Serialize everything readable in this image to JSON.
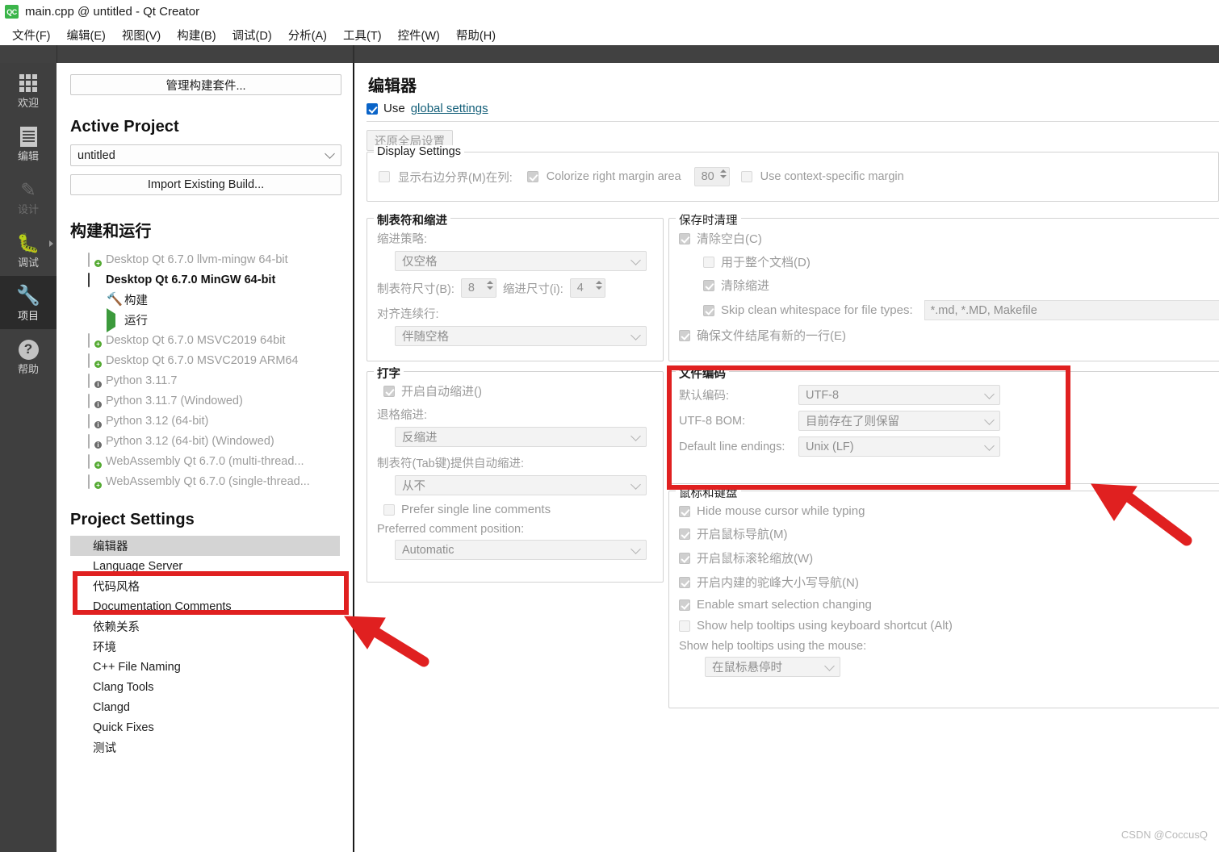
{
  "window": {
    "app_icon_label": "QC",
    "title": "main.cpp @ untitled - Qt Creator"
  },
  "menubar": [
    {
      "label": "文件(F)"
    },
    {
      "label": "编辑(E)"
    },
    {
      "label": "视图(V)"
    },
    {
      "label": "构建(B)"
    },
    {
      "label": "调试(D)"
    },
    {
      "label": "分析(A)"
    },
    {
      "label": "工具(T)"
    },
    {
      "label": "控件(W)"
    },
    {
      "label": "帮助(H)"
    }
  ],
  "mode_rail": [
    {
      "label": "欢迎",
      "icon": "grid-icon",
      "state": "normal"
    },
    {
      "label": "编辑",
      "icon": "document-icon",
      "state": "normal"
    },
    {
      "label": "设计",
      "icon": "pencil-icon",
      "state": "disabled"
    },
    {
      "label": "调试",
      "icon": "bug-icon",
      "state": "normal"
    },
    {
      "label": "项目",
      "icon": "wrench-icon",
      "state": "selected"
    },
    {
      "label": "帮助",
      "icon": "question-mark-icon",
      "state": "normal"
    }
  ],
  "left_panel": {
    "manage_kits_button": "管理构建套件...",
    "active_project_heading": "Active Project",
    "project_combo_value": "untitled",
    "import_build_button": "Import Existing Build...",
    "build_run_heading": "构建和运行",
    "kits": [
      {
        "label": "Desktop Qt 6.7.0 llvm-mingw 64-bit",
        "icon": "screen-plus-icon",
        "state": "disabled",
        "level": 0
      },
      {
        "label": "Desktop Qt 6.7.0 MinGW 64-bit",
        "icon": "screen-icon",
        "state": "active",
        "level": 0
      },
      {
        "label": "构建",
        "icon": "hammer-icon",
        "state": "normal",
        "level": 1
      },
      {
        "label": "运行",
        "icon": "play-icon",
        "state": "normal",
        "level": 1
      },
      {
        "label": "Desktop Qt 6.7.0 MSVC2019 64bit",
        "icon": "screen-plus-icon",
        "state": "disabled",
        "level": 0
      },
      {
        "label": "Desktop Qt 6.7.0 MSVC2019 ARM64",
        "icon": "screen-plus-icon",
        "state": "disabled",
        "level": 0
      },
      {
        "label": "Python 3.11.7",
        "icon": "screen-info-icon",
        "state": "disabled",
        "level": 0
      },
      {
        "label": "Python 3.11.7 (Windowed)",
        "icon": "screen-info-icon",
        "state": "disabled",
        "level": 0
      },
      {
        "label": "Python 3.12 (64-bit)",
        "icon": "screen-info-icon",
        "state": "disabled",
        "level": 0
      },
      {
        "label": "Python 3.12 (64-bit) (Windowed)",
        "icon": "screen-info-icon",
        "state": "disabled",
        "level": 0
      },
      {
        "label": "WebAssembly Qt 6.7.0 (multi-thread...",
        "icon": "screen-plus-icon",
        "state": "disabled",
        "level": 0
      },
      {
        "label": "WebAssembly Qt 6.7.0 (single-thread...",
        "icon": "screen-plus-icon",
        "state": "disabled",
        "level": 0
      }
    ],
    "project_settings_heading": "Project Settings",
    "settings": [
      {
        "label": "编辑器",
        "selected": true
      },
      {
        "label": "Language Server",
        "selected": false
      },
      {
        "label": "代码风格",
        "selected": false
      },
      {
        "label": "Documentation Comments",
        "selected": false
      },
      {
        "label": "依赖关系",
        "selected": false
      },
      {
        "label": "环境",
        "selected": false
      },
      {
        "label": "C++ File Naming",
        "selected": false
      },
      {
        "label": "Clang Tools",
        "selected": false
      },
      {
        "label": "Clangd",
        "selected": false
      },
      {
        "label": "Quick Fixes",
        "selected": false
      },
      {
        "label": "测试",
        "selected": false
      }
    ]
  },
  "main": {
    "page_title": "编辑器",
    "use_prefix": "Use",
    "use_global_link": "global settings",
    "restore_button": "还原全局设置",
    "display_settings": {
      "title": "Display Settings",
      "show_right_margin_label": "显示右边分界(M)在列:",
      "colorize_label": "Colorize right margin area",
      "margin_value": "80",
      "context_specific_label": "Use context-specific margin"
    },
    "tabs_indent": {
      "title": "制表符和缩进",
      "indent_policy_label": "缩进策略:",
      "indent_policy_value": "仅空格",
      "tab_size_label": "制表符尺寸(B):",
      "tab_size_value": "8",
      "indent_size_label": "缩进尺寸(i):",
      "indent_size_value": "4",
      "align_cont_label": "对齐连续行:",
      "align_cont_value": "伴随空格"
    },
    "typing": {
      "title": "打字",
      "auto_indent_label": "开启自动缩进()",
      "backspace_label": "退格缩进:",
      "backspace_value": "反缩进",
      "tab_auto_indent_label": "制表符(Tab键)提供自动缩进:",
      "tab_auto_indent_value": "从不",
      "prefer_single_line_label": "Prefer single line comments",
      "preferred_comment_pos_label": "Preferred comment position:",
      "preferred_comment_pos_value": "Automatic"
    },
    "cleanup": {
      "title": "保存时清理",
      "clean_whitespace_label": "清除空白(C)",
      "whole_document_label": "用于整个文档(D)",
      "clean_indentation_label": "清除缩进",
      "skip_clean_label": "Skip clean whitespace for file types:",
      "skip_clean_value": "*.md, *.MD, Makefile",
      "ensure_newline_label": "确保文件结尾有新的一行(E)"
    },
    "file_encoding": {
      "title": "文件编码",
      "default_encoding_label": "默认编码:",
      "default_encoding_value": "UTF-8",
      "bom_label": "UTF-8 BOM:",
      "bom_value": "目前存在了则保留",
      "line_endings_label": "Default line endings:",
      "line_endings_value": "Unix (LF)"
    },
    "mouse_keyboard": {
      "title": "鼠标和键盘",
      "hide_cursor_label": "Hide mouse cursor while typing",
      "mouse_nav_label": "开启鼠标导航(M)",
      "wheel_zoom_label": "开启鼠标滚轮缩放(W)",
      "camel_case_label": "开启内建的驼峰大小写导航(N)",
      "smart_selection_label": "Enable smart selection changing",
      "tooltip_shortcut_label": "Show help tooltips using keyboard shortcut (Alt)",
      "tooltip_mouse_label": "Show help tooltips using the mouse:",
      "tooltip_mouse_value": "在鼠标悬停时"
    }
  },
  "annotations": {
    "highlight_color": "#e02020",
    "watermark": "CSDN @CoccusQ"
  }
}
